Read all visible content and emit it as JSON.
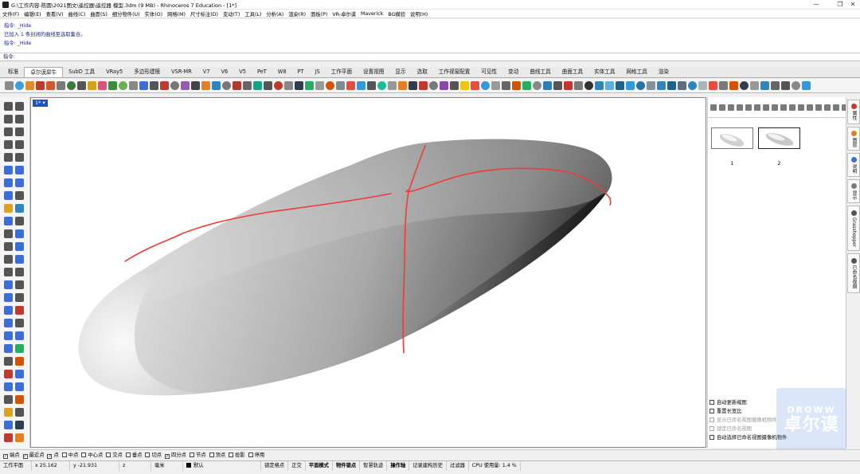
{
  "window": {
    "title": "G:\\工作内容-陈圆\\2021图文\\遥控器\\遥控器 模型.3dm (9 MB) - Rhinoceros 7 Education - [1*]",
    "minimize": "—",
    "restore": "❐",
    "close": "✕"
  },
  "menu": [
    "文件(F)",
    "编辑(E)",
    "查看(V)",
    "曲线(C)",
    "曲面(S)",
    "细分物件(U)",
    "实体(O)",
    "网格(M)",
    "尺寸标注(D)",
    "变动(T)",
    "工具(L)",
    "分析(A)",
    "渲染(R)",
    "面板(P)",
    "VR-卓尔谟",
    "Maverick",
    "BG模验",
    "说明(H)"
  ],
  "command_history": [
    "指令: _Hide",
    "已加入 1 条封闭的曲线至选取集合。",
    "指令: _Hide"
  ],
  "command_prompt": "指令:",
  "tabs": [
    "标准",
    "卓尔谟犀牛",
    "SubD 工具",
    "VRay5",
    "多边形建模",
    "VSR-MR",
    "V7",
    "V6",
    "V5",
    "PeT",
    "W8",
    "PT",
    "JS",
    "工作平面",
    "设置视图",
    "显示",
    "选取",
    "工作视窗配置",
    "可见性",
    "变动",
    "曲线工具",
    "曲面工具",
    "实体工具",
    "网格工具",
    "渲染"
  ],
  "active_tab": "卓尔谟犀牛",
  "viewport": {
    "label": "1* ▾"
  },
  "toolbar_icon_colors": [
    "#8b8b8b",
    "#3aa0d8",
    "#e08c2a",
    "#c0392b",
    "#d25a2a",
    "#7a7a7a",
    "#3a7d3a",
    "#555",
    "#d4a017",
    "#e0507a",
    "#3b8b3b",
    "#6ab04c",
    "#888",
    "#3a6fd8",
    "#555",
    "#c0392b",
    "#777",
    "#9b59b6",
    "#444",
    "#e67e22",
    "#2e86c1",
    "#777",
    "#b03a2e",
    "#666",
    "#16a085",
    "#555",
    "#c0392b",
    "#888",
    "#2c3e50",
    "#27ae60",
    "#999",
    "#d35400",
    "#7f8c8d",
    "#e74c3c",
    "#3498db",
    "#555",
    "#1abc9c",
    "#999",
    "#e67e22",
    "#2c3e50",
    "#c0392b",
    "#777",
    "#8e44ad",
    "#555",
    "#f1c40f",
    "#e74c3c",
    "#3498db",
    "#999",
    "#666",
    "#d35400",
    "#27ae60",
    "#888",
    "#2980b9",
    "#555",
    "#c0392b",
    "#7a7a7a",
    "#333",
    "#2e86c1",
    "#5dade2",
    "#1f618d",
    "#3498db",
    "#2874a6",
    "#85929e",
    "#2e86c1",
    "#1f618d",
    "#5d6d7e",
    "#2e86c1",
    "#aab7b8",
    "#e74c3c",
    "#7a7a7a",
    "#d35400",
    "#2c3e50",
    "#999",
    "#2e86c1",
    "#666",
    "#555",
    "#888",
    "#3498db"
  ],
  "left_icon_colors": [
    "#555",
    "#555",
    "#555",
    "#555",
    "#555",
    "#555",
    "#555",
    "#555",
    "#555",
    "#555",
    "#3a6fd8",
    "#3a6fd8",
    "#3a6fd8",
    "#3a6fd8",
    "#3a6fd8",
    "#555",
    "#e0a020",
    "#2e86c1",
    "#3a6fd8",
    "#555",
    "#555",
    "#3a6fd8",
    "#555",
    "#3a6fd8",
    "#555",
    "#3a6fd8",
    "#555",
    "#555",
    "#3a6fd8",
    "#555",
    "#3a6fd8",
    "#555",
    "#3a6fd8",
    "#c0392b",
    "#3a6fd8",
    "#555",
    "#3a6fd8",
    "#3a6fd8",
    "#3a6fd8",
    "#27ae60",
    "#555",
    "#d35400",
    "#c0392b",
    "#3a6fd8",
    "#3a6fd8",
    "#3a6fd8",
    "#555",
    "#d35400",
    "#e0a020",
    "#555",
    "#3a6fd8",
    "#2c3e50",
    "#c0392b",
    "#e67e22"
  ],
  "right_panel": {
    "thumbnails": [
      {
        "number": "1"
      },
      {
        "number": "2"
      }
    ],
    "options": [
      {
        "label": "自动更新缩图",
        "enabled": true
      },
      {
        "label": "重置长宽比",
        "enabled": true
      },
      {
        "label": "显示已命名视图摄像机物件",
        "enabled": false
      },
      {
        "label": "锁定已命名视图",
        "enabled": false
      },
      {
        "label": "自动选择已命名视图摄像机物件",
        "enabled": true
      }
    ]
  },
  "side_tabs": [
    {
      "label": "属性",
      "icon_color": "#d93025"
    },
    {
      "label": "图层",
      "icon_color": "#e67e22"
    },
    {
      "label": "说明",
      "icon_color": "#3a6fd8"
    },
    {
      "label": "显示",
      "icon_color": "#7a7a7a"
    },
    {
      "label": "Grasshopper",
      "icon_color": "#555555"
    },
    {
      "label": "已命名视图",
      "icon_color": "#555555"
    }
  ],
  "watermark": {
    "en": "DROWW",
    "zh": "卓尔谟"
  },
  "osnaps": [
    {
      "label": "端点",
      "checked": true
    },
    {
      "label": "最近点",
      "checked": true
    },
    {
      "label": "点",
      "checked": true
    },
    {
      "label": "中点",
      "checked": false
    },
    {
      "label": "中心点",
      "checked": false
    },
    {
      "label": "交点",
      "checked": false
    },
    {
      "label": "垂点",
      "checked": false
    },
    {
      "label": "切点",
      "checked": false
    },
    {
      "label": "四分点",
      "checked": true
    },
    {
      "label": "节点",
      "checked": false
    },
    {
      "label": "顶点",
      "checked": false
    },
    {
      "label": "投影",
      "checked": false
    },
    {
      "label": "停用",
      "checked": false
    }
  ],
  "status": {
    "cplane": "工作平面",
    "x": "x 25.162",
    "y": "y -21.931",
    "z": "z",
    "unit": "毫米",
    "layer": "默认",
    "items": [
      {
        "label": "锁定格点",
        "bold": false
      },
      {
        "label": "正交",
        "bold": false
      },
      {
        "label": "平面模式",
        "bold": true
      },
      {
        "label": "物件锁点",
        "bold": true
      },
      {
        "label": "智慧轨迹",
        "bold": false
      },
      {
        "label": "操作轴",
        "bold": true
      },
      {
        "label": "记录建构历史",
        "bold": false
      },
      {
        "label": "过滤器",
        "bold": false
      },
      {
        "label": "CPU 使用量: 1.4 %",
        "bold": false
      }
    ]
  }
}
